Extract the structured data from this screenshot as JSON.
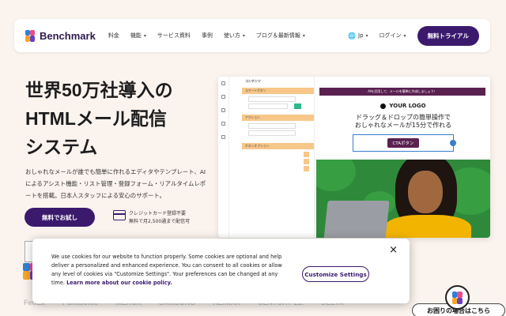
{
  "header": {
    "brand": "Benchmark",
    "menu": [
      {
        "label": "料金",
        "has_dropdown": false
      },
      {
        "label": "機能",
        "has_dropdown": true
      },
      {
        "label": "サービス資料",
        "has_dropdown": false
      },
      {
        "label": "事例",
        "has_dropdown": false
      },
      {
        "label": "使い方",
        "has_dropdown": true
      },
      {
        "label": "ブログ＆最新情報",
        "has_dropdown": true
      }
    ],
    "language": "Jp",
    "login": "ログイン",
    "trial_button": "無料トライアル"
  },
  "hero": {
    "title_lines": [
      "世界50万社導入の",
      "HTMLメール配信",
      "システム"
    ],
    "description": "おしゃれなメールが誰でも簡単に作れるエディタやテンプレート、AIによるアシスト機能・リスト管理・登録フォーム・リアルタイムレポートを搭載。日本人スタッフによる安心のサポート。",
    "cta_button": "無料でお試し",
    "cc_line1": "クレジットカード登録不要",
    "cc_line2": "無料で月2,500通まで配信可"
  },
  "editor": {
    "panel_title": "コンテンツ",
    "panel_item": "スマートボタン",
    "action_label": "アクション",
    "button_options": "ボタンオプション",
    "banner": "AIを活用して、メールを簡単に作成しましょう！",
    "logo_text": "YOUR LOGO",
    "headline_1": "ドラッグ＆ドロップの簡単操作で",
    "headline_2": "おしゃれなメールが15分で作れる",
    "cta_label": "CTAボタン"
  },
  "cookie": {
    "text": "We use cookies for our website to function properly. Some cookies are optional and help deliver a personalized and enhanced experience. You can consent to all cookies or allow any level of cookies via \"Customize Settings\". Your preferences can be changed at any time.",
    "link": "Learn more about our cookie policy.",
    "button": "Customize Settings",
    "close": "×"
  },
  "brands": [
    "FedEx",
    "Panasonic",
    "MERCK",
    "SAMSUNG",
    "RE/MAX",
    "CENTURY 21",
    "CENTURY 21.",
    "DELTA"
  ],
  "help": "お困りの場合はこちら",
  "colors": {
    "brand_purple": "#3b1a6e",
    "background": "#fbf4ee"
  }
}
